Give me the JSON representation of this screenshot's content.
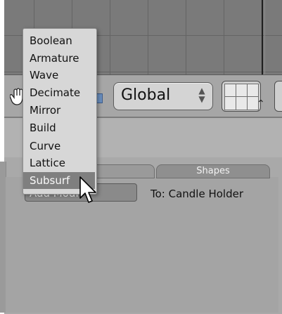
{
  "header": {
    "view_mode_label": "Global",
    "view_mode_arrows": "⇕"
  },
  "menu": {
    "items": [
      {
        "label": "Boolean"
      },
      {
        "label": "Armature"
      },
      {
        "label": "Wave"
      },
      {
        "label": "Decimate"
      },
      {
        "label": "Mirror"
      },
      {
        "label": "Build"
      },
      {
        "label": "Curve"
      },
      {
        "label": "Lattice"
      },
      {
        "label": "Subsurf",
        "active": true
      }
    ]
  },
  "panel": {
    "tabs": {
      "modifiers_label_partial": "s",
      "shapes_label": "Shapes"
    },
    "add_modifier_label": "Add Modi",
    "target_label": "To: Candle Holder"
  },
  "icons": {
    "hand": "hand-grab-icon",
    "cursor": "mouse-pointer-icon"
  },
  "colors": {
    "menu_bg": "#d7d7d7",
    "menu_active_bg": "#7f7f7f",
    "panel_bg": "#a9a9a9",
    "viewport_bg": "#7a7a7a"
  }
}
